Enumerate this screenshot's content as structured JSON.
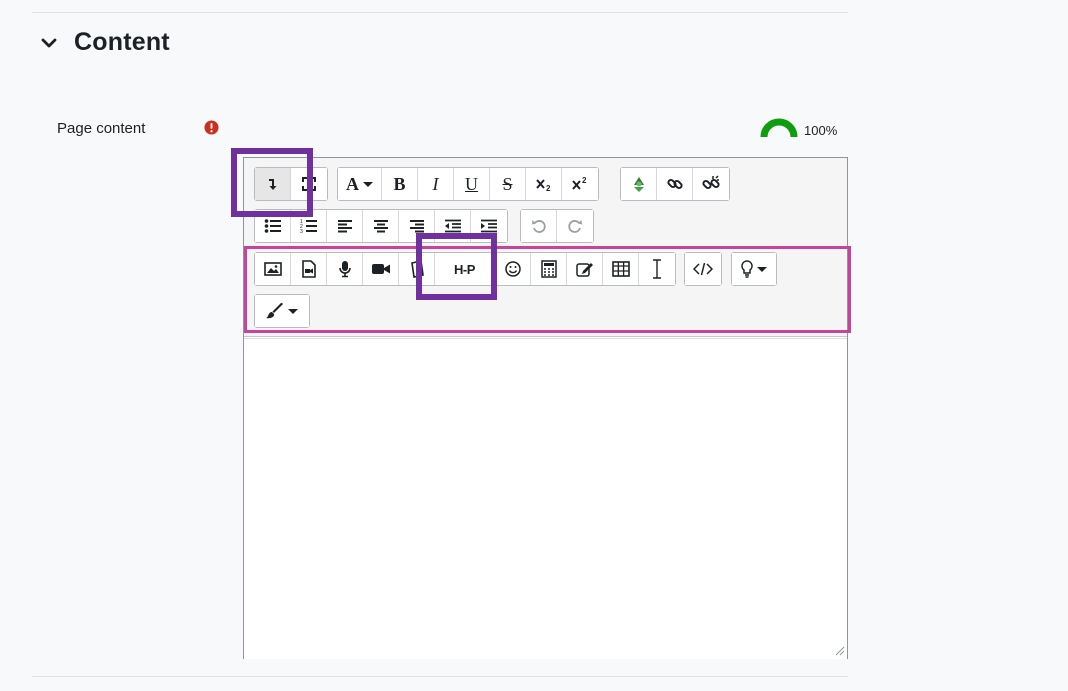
{
  "section": {
    "title": "Content",
    "collapse_icon": "chevron-down-icon"
  },
  "field": {
    "label": "Page content",
    "required_icon": "exclamation-circle-icon",
    "required_color": "#ca3120"
  },
  "accessibility": {
    "progress_text": "100%",
    "indicator_color": "#0f9d0f",
    "indicator_level": 1.0
  },
  "toolbar": {
    "row1": {
      "collapse_group": [
        "collapse-toolbar-icon",
        "fullscreen-icon"
      ],
      "format_group": [
        "font-style-icon",
        "bold-icon",
        "italic-icon",
        "underline-icon",
        "strikethrough-icon",
        "subscript-icon",
        "superscript-icon"
      ],
      "link_group": [
        "recycle-icon",
        "link-icon",
        "unlink-icon"
      ],
      "labels": {
        "font": "A",
        "bold": "B",
        "italic": "I",
        "underline": "U",
        "strike": "S"
      }
    },
    "row2": {
      "list_align_group": [
        "unordered-list-icon",
        "ordered-list-icon",
        "align-left-icon",
        "align-center-icon",
        "align-right-icon",
        "outdent-icon",
        "indent-icon"
      ],
      "history_group": [
        "undo-icon",
        "redo-icon"
      ]
    },
    "row3": {
      "media_group": [
        "image-icon",
        "media-icon",
        "record-audio-icon",
        "record-video-icon",
        "manage-files-icon",
        "h5p-icon",
        "emoji-icon",
        "equation-icon",
        "annotation-icon",
        "table-icon",
        "text-cursor-icon"
      ],
      "h5p_label": "H-P",
      "html_group": [
        "html-code-icon"
      ],
      "accessibility_group": [
        "lightbulb-icon"
      ],
      "style_group": [
        "brush-icon"
      ]
    }
  },
  "highlights": {
    "purple": "#7030a0",
    "pink": "#c8449a"
  }
}
